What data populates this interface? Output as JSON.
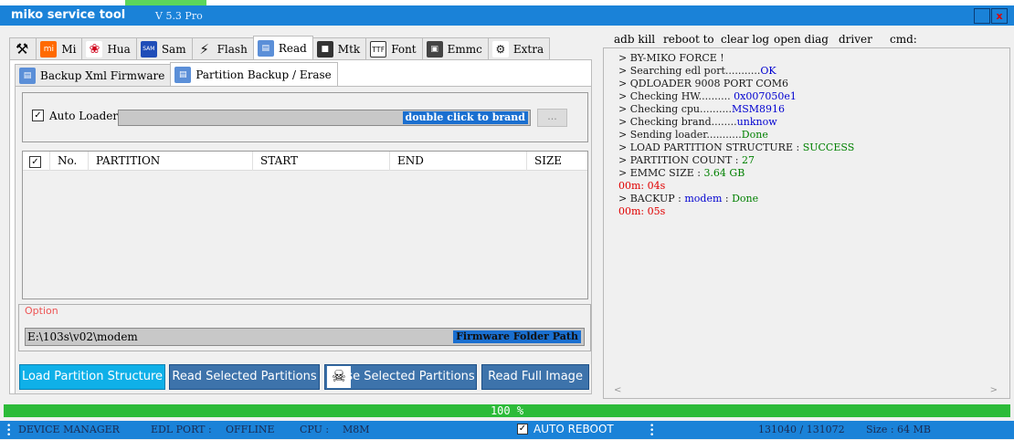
{
  "window": {
    "title": "miko service tool",
    "version": "V 5.3 Pro",
    "close_glyph": "x"
  },
  "main_tabs": [
    {
      "label": "",
      "icon": "tools-icon"
    },
    {
      "label": "Mi",
      "icon": "mi-logo-icon"
    },
    {
      "label": "Hua",
      "icon": "huawei-logo-icon"
    },
    {
      "label": "Sam",
      "icon": "samsung-logo-icon"
    },
    {
      "label": "Flash",
      "icon": "lightning-icon"
    },
    {
      "label": "Read",
      "icon": "database-icon",
      "active": true
    },
    {
      "label": "Mtk",
      "icon": "chip-icon"
    },
    {
      "label": "Font",
      "icon": "font-file-icon"
    },
    {
      "label": "Emmc",
      "icon": "emmc-chip-icon"
    },
    {
      "label": "Extra",
      "icon": "extra-icon"
    }
  ],
  "sub_tabs": [
    {
      "label": "Backup Xml Firmware"
    },
    {
      "label": "Partition Backup / Erase",
      "active": true
    }
  ],
  "loader": {
    "checkbox_label": "Auto Loader",
    "checked": true,
    "field_hint": "double click to brand",
    "browse_label": "..."
  },
  "table": {
    "columns": [
      "No.",
      "PARTITION",
      "START",
      "END",
      "SIZE"
    ],
    "rows": []
  },
  "option": {
    "label": "Option",
    "path_value": "E:\\103s\\v02\\modem",
    "path_hint": "Firmware Folder Path"
  },
  "actions": {
    "load": "Load Partition Structure",
    "read_selected": "Read Selected Partitions",
    "erase_selected": "se Selected Partitions",
    "read_full": "Read Full Image"
  },
  "right_menu": [
    "adb kill",
    "reboot to",
    "clear log",
    "open diag",
    "driver",
    "cmd:"
  ],
  "log": [
    {
      "parts": [
        {
          "t": " > BY-MIKO FORCE !",
          "c": "#1a1a1a"
        }
      ]
    },
    {
      "parts": [
        {
          "t": " > Searching edl port...........",
          "c": "#1a1a1a"
        },
        {
          "t": "OK",
          "c": "#0000d0"
        }
      ]
    },
    {
      "parts": [
        {
          "t": " > QDLOADER 9008 PORT COM6",
          "c": "#1a1a1a"
        }
      ]
    },
    {
      "parts": [
        {
          "t": " > Checking HW.......... ",
          "c": "#1a1a1a"
        },
        {
          "t": "0x007050e1",
          "c": "#0000d0"
        }
      ]
    },
    {
      "parts": [
        {
          "t": " > Checking cpu..........",
          "c": "#1a1a1a"
        },
        {
          "t": "MSM8916",
          "c": "#0000d0"
        }
      ]
    },
    {
      "parts": [
        {
          "t": " > Checking brand........",
          "c": "#1a1a1a"
        },
        {
          "t": "unknow",
          "c": "#0000d0"
        }
      ]
    },
    {
      "parts": [
        {
          "t": " > Sending loader...........",
          "c": "#1a1a1a"
        },
        {
          "t": "Done",
          "c": "#008000"
        }
      ]
    },
    {
      "parts": [
        {
          "t": " > LOAD PARTITION  STRUCTURE  :  ",
          "c": "#1a1a1a"
        },
        {
          "t": "SUCCESS",
          "c": "#008000"
        }
      ]
    },
    {
      "parts": [
        {
          "t": " > PARTITION COUNT  :  ",
          "c": "#1a1a1a"
        },
        {
          "t": "27",
          "c": "#008000"
        }
      ]
    },
    {
      "parts": [
        {
          "t": " > EMMC SIZE   :  ",
          "c": "#1a1a1a"
        },
        {
          "t": "3.64 GB",
          "c": "#008000"
        }
      ]
    },
    {
      "parts": [
        {
          "t": "00m: 04s",
          "c": "#e00000"
        }
      ]
    },
    {
      "parts": [
        {
          "t": " > BACKUP   :   ",
          "c": "#1a1a1a"
        },
        {
          "t": "modem",
          "c": "#0000d0"
        },
        {
          "t": "   :   ",
          "c": "#1a1a1a"
        },
        {
          "t": "Done",
          "c": "#008000"
        }
      ]
    },
    {
      "parts": [
        {
          "t": "00m: 05s",
          "c": "#e00000"
        }
      ]
    }
  ],
  "progress": {
    "value": 100,
    "text": "100  %"
  },
  "status": {
    "device_manager": "DEVICE MANAGER",
    "edl_port_label": "EDL PORT :",
    "edl_port_value": "OFFLINE",
    "cpu_label": "CPU :",
    "cpu_value": "M8M",
    "auto_reboot": "AUTO REBOOT",
    "auto_reboot_checked": true,
    "counts": "131040   /   131072",
    "size": "Size  :  64 MB"
  },
  "colors": {
    "titlebar": "#1a82d8",
    "progress": "#2cbb39",
    "accent_button": "#0fb0e8",
    "button": "#3d73ab"
  }
}
